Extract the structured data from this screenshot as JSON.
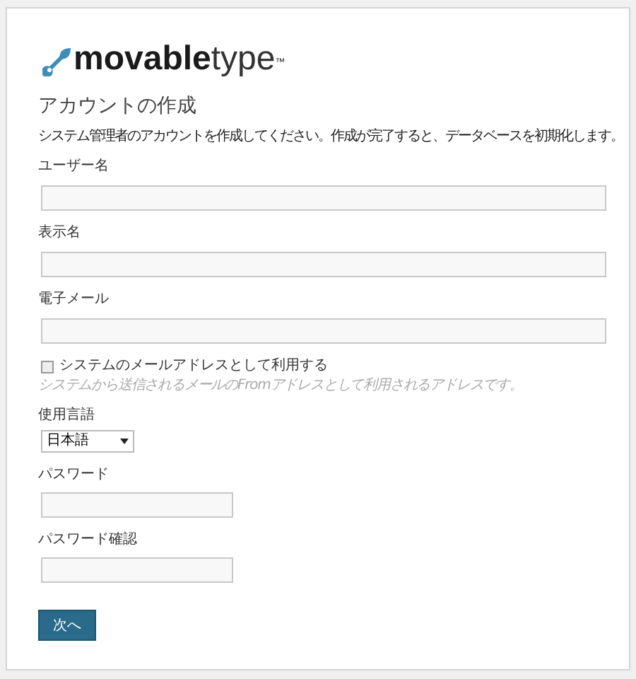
{
  "logo": {
    "bold": "movable",
    "light": "type",
    "mark": "™"
  },
  "title": "アカウントの作成",
  "description": "システム管理者のアカウントを作成してください。作成が完了すると、データベースを初期化します。",
  "fields": [
    {
      "kind": "text",
      "label": "ユーザー名"
    },
    {
      "kind": "text",
      "label": "表示名"
    },
    {
      "kind": "text",
      "label": "電子メール"
    },
    {
      "kind": "checkbox",
      "label": "システムのメールアドレスとして利用する",
      "checked": false,
      "hint": "システムから送信されるメールのFromアドレスとして利用されるアドレスです。"
    },
    {
      "kind": "select",
      "label": "使用言語",
      "value": "日本語"
    },
    {
      "kind": "short",
      "label": "パスワード"
    },
    {
      "kind": "short",
      "label": "パスワード確認"
    }
  ],
  "button": "次へ"
}
